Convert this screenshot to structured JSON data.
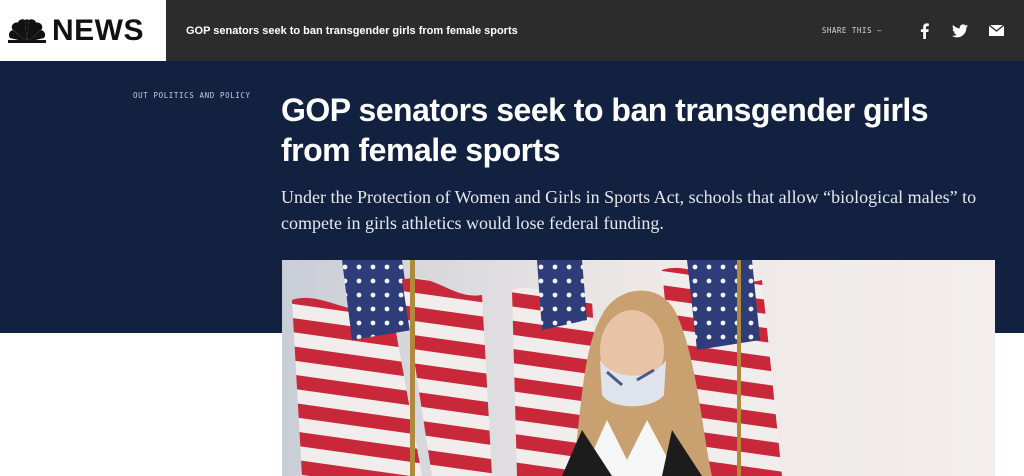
{
  "topbar": {
    "logo_text": "NEWS",
    "article_title": "GOP senators seek to ban transgender girls from female sports",
    "share_label": "SHARE THIS —",
    "share_icons": [
      "facebook-icon",
      "twitter-icon",
      "email-icon"
    ]
  },
  "hero": {
    "section_label": "OUT POLITICS AND POLICY",
    "headline": "GOP senators seek to ban transgender girls from female sports",
    "dek": "Under the Protection of Women and Girls in Sports Act, schools that allow “biological males” to compete in girls athletics would lose federal funding."
  },
  "colors": {
    "topbar_bg": "#2c2c2c",
    "hero_bg": "#12213f",
    "headline": "#ffffff"
  }
}
